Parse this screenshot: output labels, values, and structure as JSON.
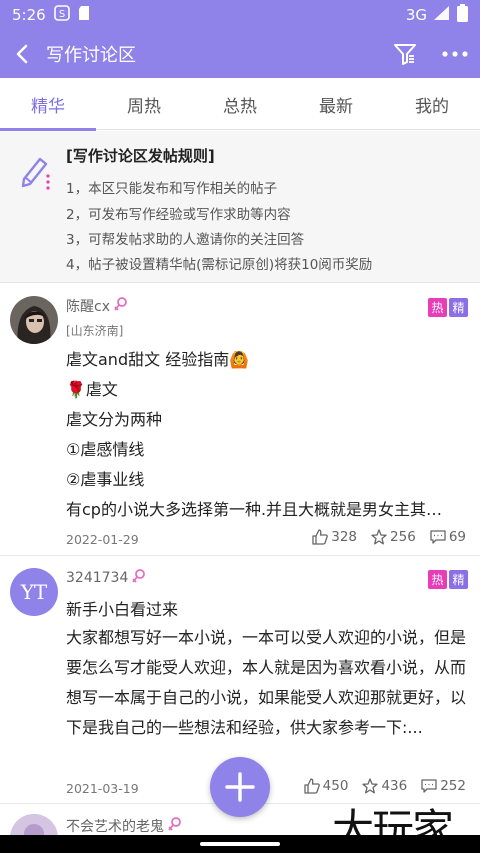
{
  "status_bar": {
    "time": "5:26",
    "network": "3G"
  },
  "app_bar": {
    "title": "写作讨论区"
  },
  "tabs": [
    {
      "label": "精华",
      "active": true
    },
    {
      "label": "周热",
      "active": false
    },
    {
      "label": "总热",
      "active": false
    },
    {
      "label": "最新",
      "active": false
    },
    {
      "label": "我的",
      "active": false
    }
  ],
  "rules": {
    "title": "[写作讨论区发帖规则]",
    "lines": [
      "1，本区只能发布和写作相关的帖子",
      "2，可发布写作经验或写作求助等内容",
      "3，可帮发帖求助的人邀请你的关注回答",
      "4，帖子被设置精华帖(需标记原创)将获10阅币奖励"
    ]
  },
  "posts": [
    {
      "user": "陈醒cx",
      "location": "[山东济南]",
      "badges": [
        "热",
        "精"
      ],
      "lines": [
        "虐文and甜文 经验指南🙆",
        "🌹虐文",
        "虐文分为两种",
        "①虐感情线",
        "②虐事业线",
        "有cp的小说大多选择第一种.并且大概就是男女主其…"
      ],
      "date": "2022-01-29",
      "likes": "328",
      "stars": "256",
      "comments": "69"
    },
    {
      "user": "3241734",
      "avatar_text": "YT",
      "badges": [
        "热",
        "精"
      ],
      "title": "新手小白看过来",
      "body": "大家都想写好一本小说，一本可以受人欢迎的小说，但是要怎么写才能受人欢迎，本人就是因为喜欢看小说，从而想写一本属于自己的小说，如果能受人欢迎那就更好，以下是我自己的一些想法和经验，供大家参考一下:...",
      "date": "2021-03-19",
      "likes": "450",
      "stars": "436",
      "comments": "252"
    },
    {
      "user": "不会艺术的老鬼"
    }
  ],
  "watermark": "大玩家",
  "colors": {
    "accent": "#8f82e8",
    "hot": "#e83cb9",
    "best": "#8a6fe6"
  }
}
